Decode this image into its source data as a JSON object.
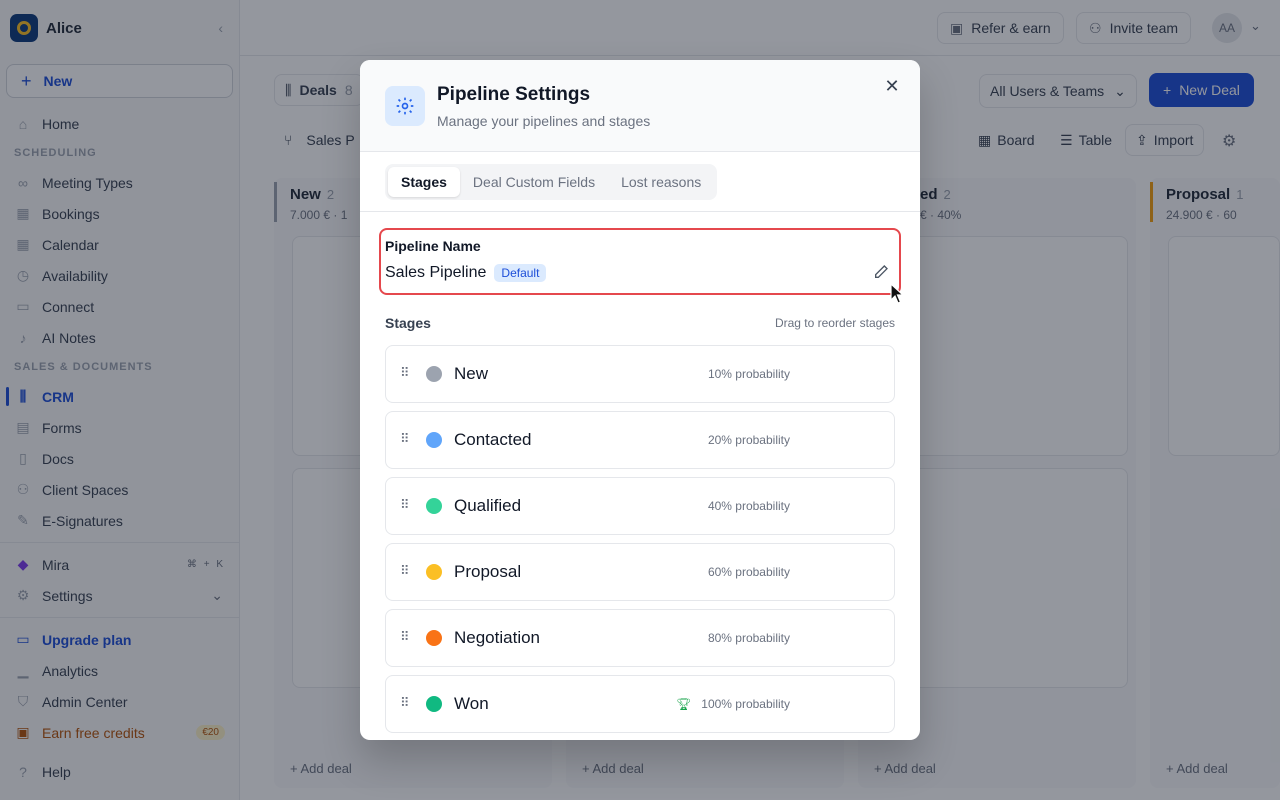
{
  "workspace": {
    "name": "Alice"
  },
  "sidebar": {
    "new_label": "New",
    "home": "Home",
    "section_scheduling": "SCHEDULING",
    "scheduling_items": [
      "Meeting Types",
      "Bookings",
      "Calendar",
      "Availability",
      "Connect",
      "AI Notes"
    ],
    "section_sales": "SALES & DOCUMENTS",
    "sales_items": [
      "CRM",
      "Forms",
      "Docs",
      "Client Spaces",
      "E-Signatures"
    ],
    "mira": "Mira",
    "mira_shortcut": "⌘ + K",
    "settings": "Settings",
    "upgrade": "Upgrade plan",
    "analytics": "Analytics",
    "admin": "Admin Center",
    "credits": "Earn free credits",
    "credits_badge": "€20",
    "help": "Help"
  },
  "topbar": {
    "refer": "Refer & earn",
    "invite": "Invite team",
    "avatar": "AA"
  },
  "main": {
    "deals_label": "Deals",
    "deals_count": "8",
    "pipeline_select": "Sales P",
    "filter": "All Users & Teams",
    "new_deal": "New Deal",
    "view_board": "Board",
    "view_table": "Table",
    "import": "Import",
    "add_deal": "Add deal",
    "columns": [
      {
        "title": "New",
        "count": "2",
        "sub": "7.000 € · 1"
      },
      {
        "title": "ed",
        "count": "2",
        "sub": "€ · 40%"
      },
      {
        "title": "Proposal",
        "count": "1",
        "sub": "24.900 € · 60"
      }
    ]
  },
  "modal": {
    "title": "Pipeline Settings",
    "subtitle": "Manage your pipelines and stages",
    "tabs": [
      "Stages",
      "Deal Custom Fields",
      "Lost reasons"
    ],
    "pipeline_name_label": "Pipeline Name",
    "pipeline_name": "Sales Pipeline",
    "default_badge": "Default",
    "stages_heading": "Stages",
    "stages_hint": "Drag to reorder stages",
    "stages": [
      {
        "name": "New",
        "probability": "10% probability",
        "color": "#9ca3af"
      },
      {
        "name": "Contacted",
        "probability": "20% probability",
        "color": "#60a5fa"
      },
      {
        "name": "Qualified",
        "probability": "40% probability",
        "color": "#34d399"
      },
      {
        "name": "Proposal",
        "probability": "60% probability",
        "color": "#fbbf24"
      },
      {
        "name": "Negotiation",
        "probability": "80% probability",
        "color": "#f97316"
      },
      {
        "name": "Won",
        "probability": "100% probability",
        "color": "#10b981"
      }
    ]
  }
}
